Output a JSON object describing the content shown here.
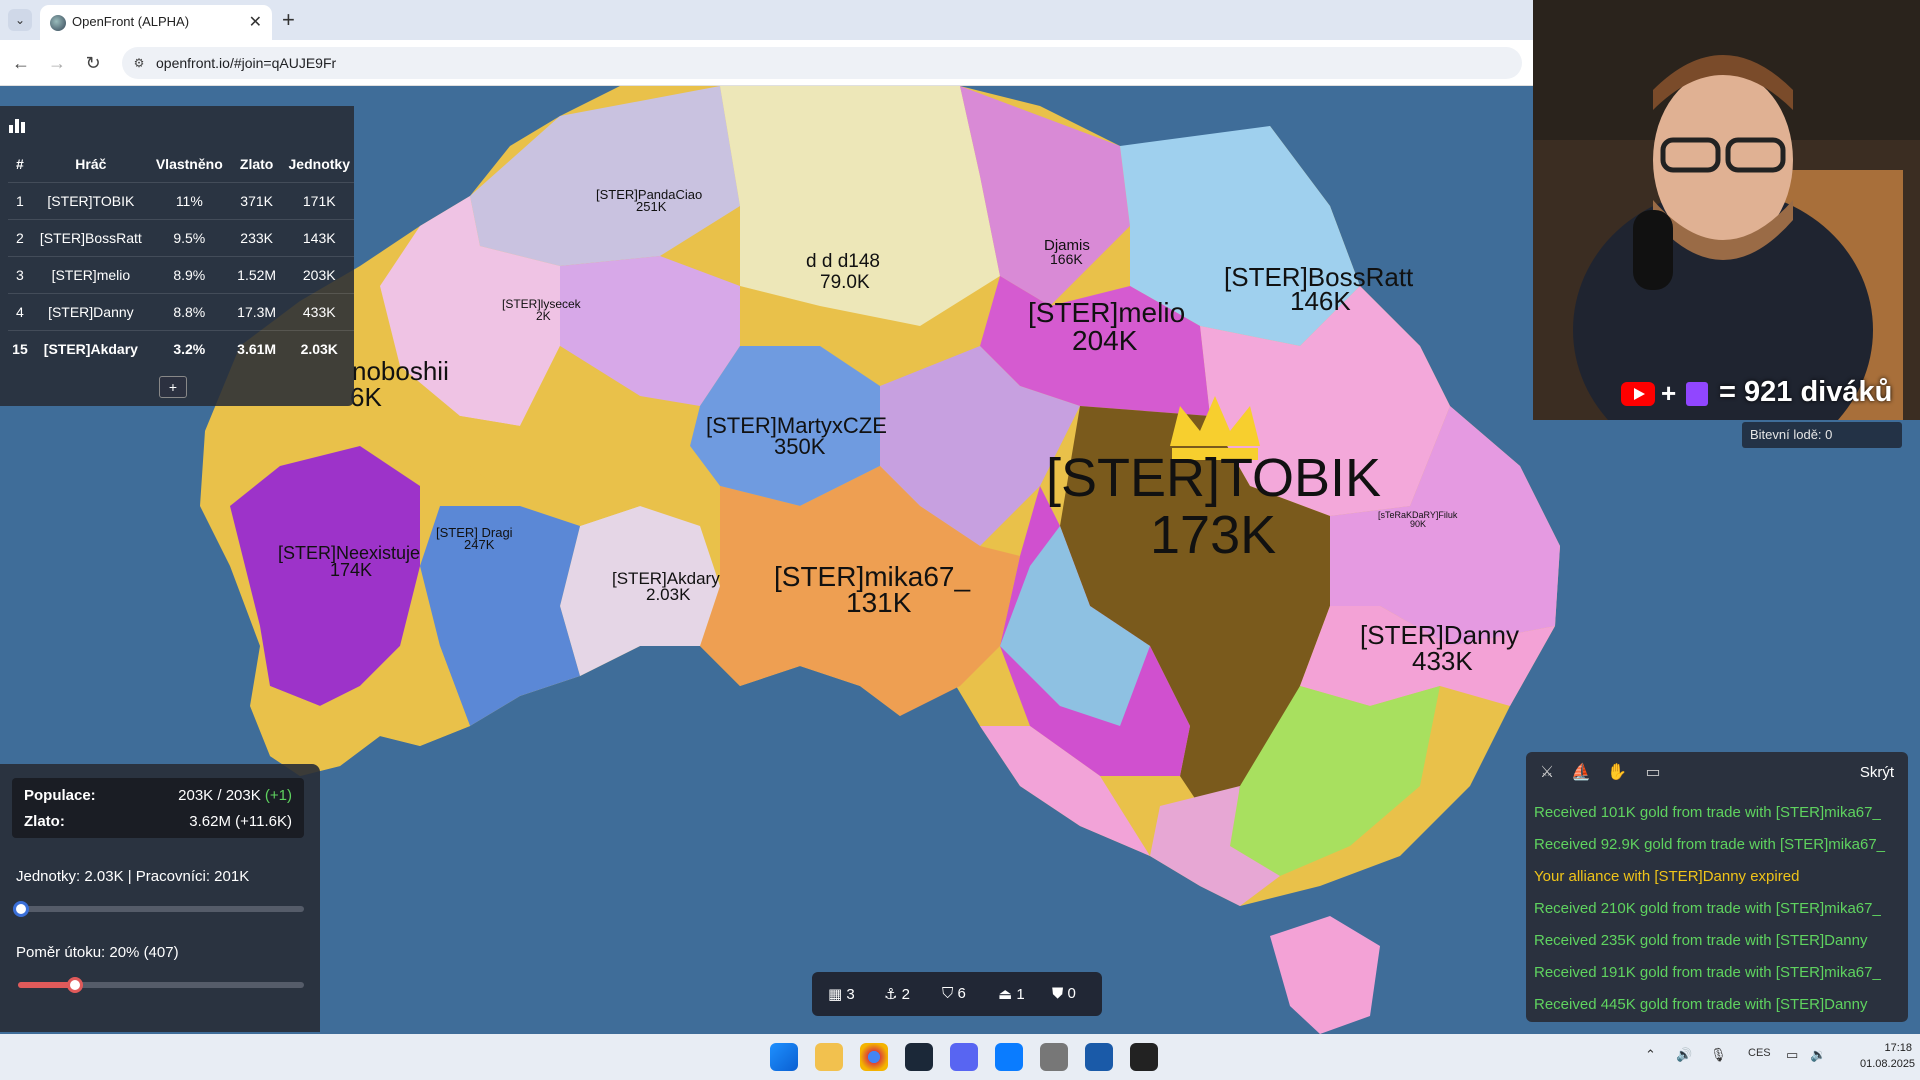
{
  "browser": {
    "tab_title": "OpenFront (ALPHA)",
    "url": "openfront.io/#join=qAUJE9Fr",
    "new_tab": "+",
    "tab_close": "✕"
  },
  "leaderboard": {
    "headers": [
      "#",
      "Hráč",
      "Vlastněno",
      "Zlato",
      "Jednotky"
    ],
    "rows": [
      {
        "rank": "1",
        "player": "[STER]TOBIK",
        "owned": "11%",
        "gold": "371K",
        "units": "171K"
      },
      {
        "rank": "2",
        "player": "[STER]BossRatt",
        "owned": "9.5%",
        "gold": "233K",
        "units": "143K"
      },
      {
        "rank": "3",
        "player": "[STER]melio",
        "owned": "8.9%",
        "gold": "1.52M",
        "units": "203K"
      },
      {
        "rank": "4",
        "player": "[STER]Danny",
        "owned": "8.8%",
        "gold": "17.3M",
        "units": "433K"
      },
      {
        "rank": "15",
        "player": "[STER]Akdary",
        "owned": "3.2%",
        "gold": "3.61M",
        "units": "2.03K"
      }
    ],
    "expand": "+"
  },
  "stats": {
    "population_label": "Populace:",
    "population_value": "203K / 203K",
    "population_delta": "(+1)",
    "gold_label": "Zlato:",
    "gold_value": "3.62M (+11.6K)",
    "units_text": "Jednotky: 2.03K | Pracovníci: 201K",
    "units_slider_fraction": 0.01,
    "attack_text": "Poměr útoku: 20% (407)",
    "attack_slider_fraction": 0.2
  },
  "map_labels": [
    {
      "name": "[STER]PandaCiao",
      "value": "251K"
    },
    {
      "name": "d d d148",
      "value": "79.0K"
    },
    {
      "name": "Djamis",
      "value": "166K"
    },
    {
      "name": "[STER]BossRatt",
      "value": "146K"
    },
    {
      "name": "[STER]melio",
      "value": "204K"
    },
    {
      "name": "[STER]lysecek",
      "value": "2K"
    },
    {
      "name": "noboshii",
      "value": "6K"
    },
    {
      "name": "[STER]MartyxCZE",
      "value": "350K"
    },
    {
      "name": "[STER]TOBIK",
      "value": "173K"
    },
    {
      "name": "[STER] Dragi",
      "value": "247K"
    },
    {
      "name": "[STER]Neexistuje",
      "value": "174K"
    },
    {
      "name": "[STER]Akdary",
      "value": "2.03K"
    },
    {
      "name": "[STER]mika67_",
      "value": "131K"
    },
    {
      "name": "[STER]Danny",
      "value": "433K"
    },
    {
      "name": "[sTeRaKDaRY]Filuk",
      "value": "90K"
    }
  ],
  "build_bar": {
    "cities": "3",
    "ports": "2",
    "defenses": "6",
    "missiles": "1",
    "sams": "0"
  },
  "warships": "Bitevní lodě: 0",
  "events": {
    "hide": "Skrýt",
    "messages": [
      {
        "text": "Received 101K gold from trade with [STER]mika67_",
        "color": "#5fd35f"
      },
      {
        "text": "Received 92.9K gold from trade with [STER]mika67_",
        "color": "#5fd35f"
      },
      {
        "text": "Your alliance with [STER]Danny expired",
        "color": "#f0c419"
      },
      {
        "text": "Received 210K gold from trade with [STER]mika67_",
        "color": "#5fd35f"
      },
      {
        "text": "Received 235K gold from trade with [STER]Danny",
        "color": "#5fd35f"
      },
      {
        "text": "Received 191K gold from trade with [STER]mika67_",
        "color": "#5fd35f"
      },
      {
        "text": "Received 445K gold from trade with [STER]Danny",
        "color": "#5fd35f"
      }
    ]
  },
  "stream": {
    "viewers": "921 diváků",
    "plus": "+",
    "equals": "="
  },
  "taskbar": {
    "lang": "CES",
    "time": "17:18",
    "date": "01.08.2025"
  }
}
